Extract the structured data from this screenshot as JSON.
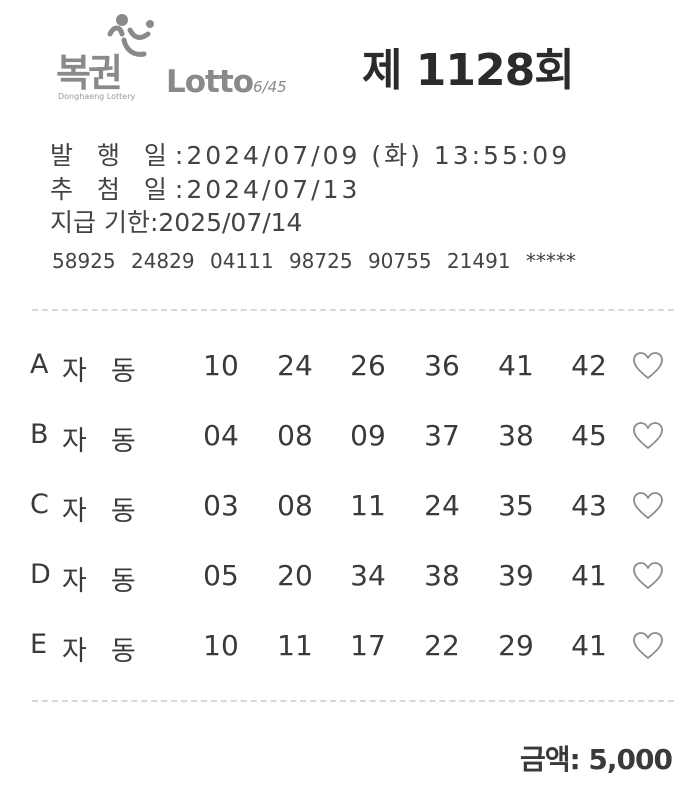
{
  "logo": {
    "brand_kr": "복권",
    "brand_en": "Donghaeng Lottery",
    "lotto": "Lotto",
    "lotto_sub": "6/45"
  },
  "round_title": "제 1128회",
  "issue": {
    "issue_label": "발 행 일",
    "issue_value": ":2024/07/09 (화) 13:55:09",
    "draw_label": "추 첨 일",
    "draw_value": ":2024/07/13",
    "deadline_label": "지급 기한",
    "deadline_value": ":2025/07/14"
  },
  "serial": [
    "58925",
    "24829",
    "04111",
    "98725",
    "90755",
    "21491",
    "*****"
  ],
  "games": [
    {
      "letter": "A",
      "mode": "자동",
      "numbers": [
        "10",
        "24",
        "26",
        "36",
        "41",
        "42"
      ]
    },
    {
      "letter": "B",
      "mode": "자동",
      "numbers": [
        "04",
        "08",
        "09",
        "37",
        "38",
        "45"
      ]
    },
    {
      "letter": "C",
      "mode": "자동",
      "numbers": [
        "03",
        "08",
        "11",
        "24",
        "35",
        "43"
      ]
    },
    {
      "letter": "D",
      "mode": "자동",
      "numbers": [
        "05",
        "20",
        "34",
        "38",
        "39",
        "41"
      ]
    },
    {
      "letter": "E",
      "mode": "자동",
      "numbers": [
        "10",
        "11",
        "17",
        "22",
        "29",
        "41"
      ]
    }
  ],
  "amount": "금액: 5,000",
  "icons": {
    "heart": "heart-outline-icon",
    "logo": "lottery-logo-icon"
  },
  "colors": {
    "text": "#3a3a3a",
    "logo_gray": "#8a8a8a",
    "heart_stroke": "#8c8c8c",
    "divider": "#d8d8d8"
  }
}
